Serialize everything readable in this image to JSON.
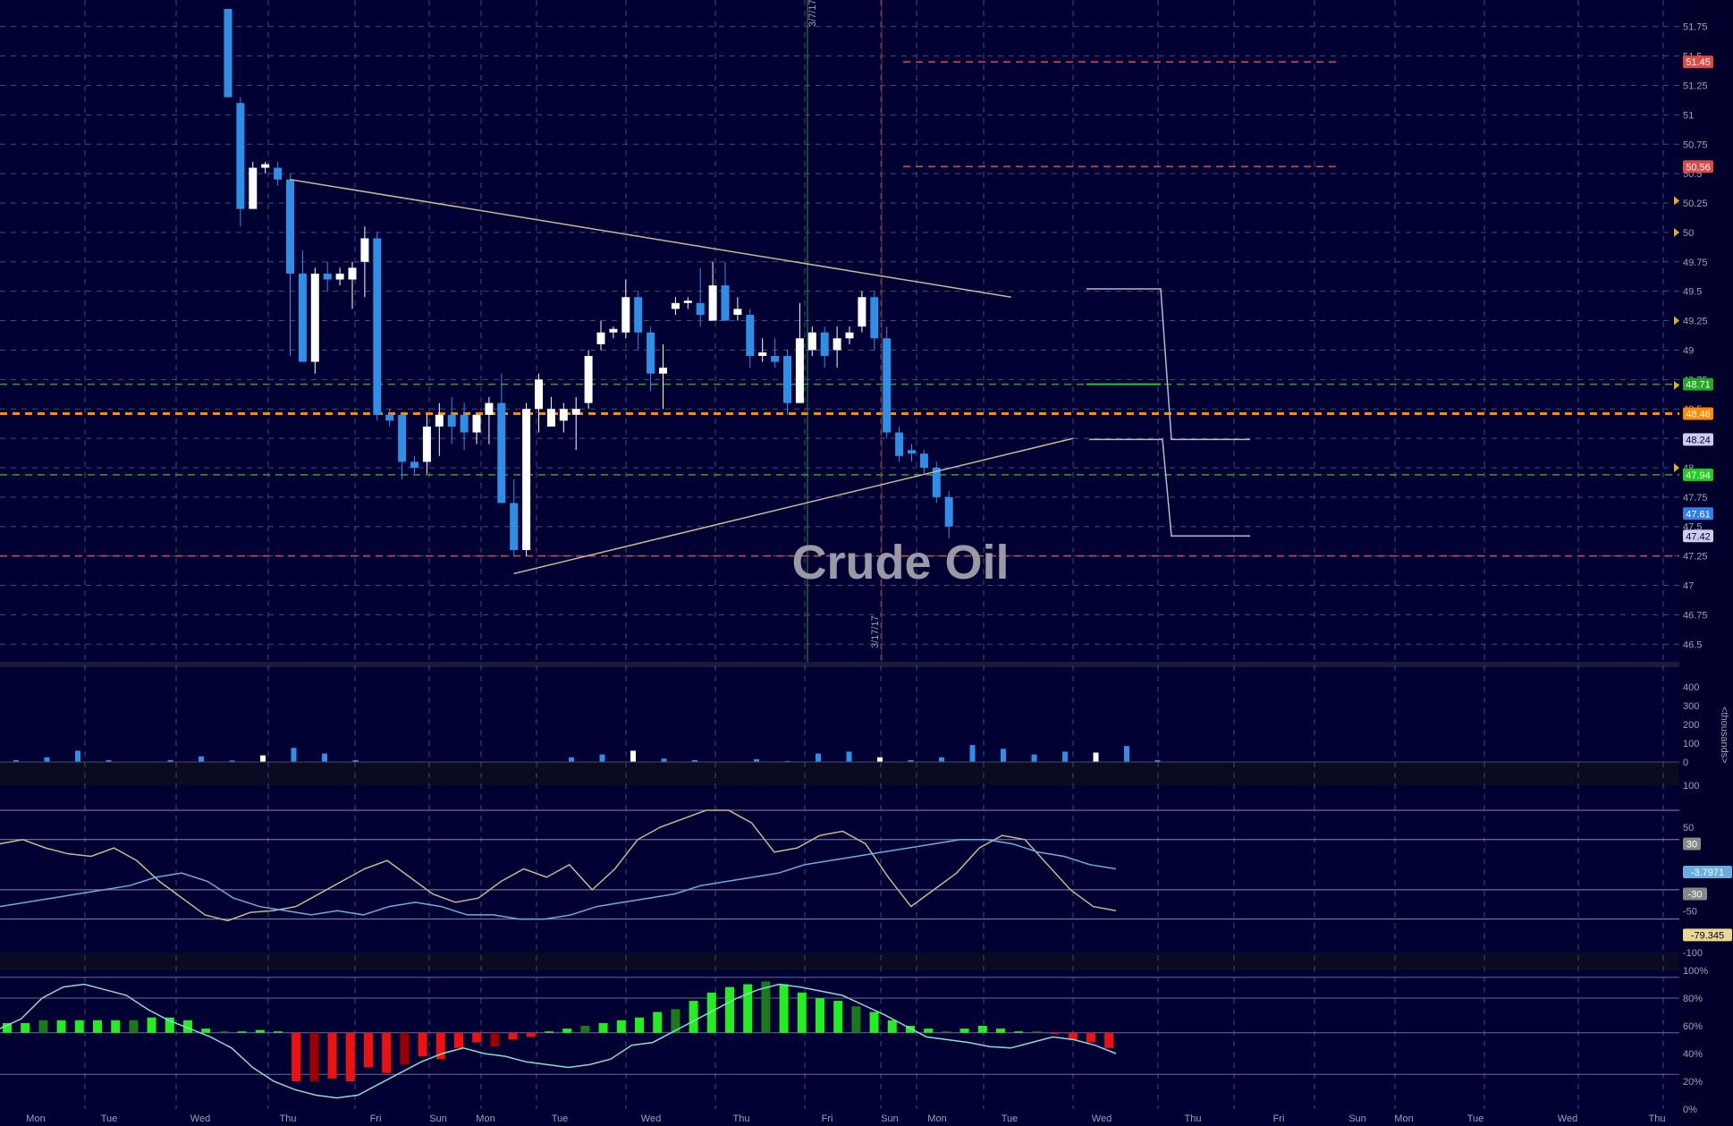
{
  "chart_data": {
    "type": "candlestick",
    "title": "Crude Oil",
    "date_labels": [
      "3/7/17",
      "3/17/17"
    ],
    "x_tick_labels": [
      "Mon",
      "Tue",
      "Wed",
      "Thu",
      "Fri",
      "Sun",
      "Mon",
      "Tue",
      "Wed",
      "Thu",
      "Fri",
      "Sun",
      "Mon",
      "Tue",
      "Wed",
      "Thu",
      "Fri",
      "Sun",
      "Mon",
      "Tue",
      "Wed",
      "Thu"
    ],
    "price_axis": {
      "ylim": [
        46.35,
        51.9
      ],
      "ticks": [
        "51.75",
        "51.5",
        "51.25",
        "51",
        "50.75",
        "50.5",
        "50.25",
        "50",
        "49.75",
        "49.5",
        "49.25",
        "49",
        "48.75",
        "48.5",
        "48.25",
        "48",
        "47.75",
        "47.5",
        "47.25",
        "47",
        "46.75",
        "46.5"
      ]
    },
    "price_badges": [
      {
        "label": "51.45",
        "value": 51.45,
        "color": "#e04848"
      },
      {
        "label": "50.56",
        "value": 50.56,
        "color": "#e04848"
      },
      {
        "label": "48.71",
        "value": 48.71,
        "color": "#22aa22"
      },
      {
        "label": "48.46",
        "value": 48.46,
        "color": "#ff8c00"
      },
      {
        "label": "48.24",
        "value": 48.24,
        "color": "#ccccee"
      },
      {
        "label": "47.94",
        "value": 47.94,
        "color": "#22cc22"
      },
      {
        "label": "47.61",
        "value": 47.61,
        "color": "#2f7fe6"
      },
      {
        "label": "47.42",
        "value": 47.42,
        "color": "#ccccee"
      }
    ],
    "levels": [
      {
        "value": 51.45,
        "style": "dashed",
        "color": "#e04848"
      },
      {
        "value": 50.56,
        "style": "dashed",
        "color": "#e04848"
      },
      {
        "value": 48.71,
        "style": "dashed",
        "color": "#22aa22"
      },
      {
        "value": 48.46,
        "style": "dashed",
        "color": "#ff8c00"
      },
      {
        "value": 47.94,
        "style": "dashed",
        "color": "#22aa22"
      },
      {
        "value": 47.25,
        "style": "dashed",
        "color": "#e04848"
      }
    ],
    "candles": [
      {
        "o": 51.9,
        "h": 51.9,
        "l": 51.15,
        "c": 51.15
      },
      {
        "o": 51.1,
        "h": 51.15,
        "l": 50.05,
        "c": 50.2
      },
      {
        "o": 50.2,
        "h": 50.6,
        "l": 50.2,
        "c": 50.55
      },
      {
        "o": 50.55,
        "h": 50.6,
        "l": 50.5,
        "c": 50.58
      },
      {
        "o": 50.55,
        "h": 50.6,
        "l": 50.4,
        "c": 50.45
      },
      {
        "o": 50.45,
        "h": 50.5,
        "l": 48.95,
        "c": 49.65
      },
      {
        "o": 49.65,
        "h": 49.85,
        "l": 48.9,
        "c": 48.9
      },
      {
        "o": 48.9,
        "h": 49.7,
        "l": 48.8,
        "c": 49.65
      },
      {
        "o": 49.65,
        "h": 49.75,
        "l": 49.5,
        "c": 49.6
      },
      {
        "o": 49.6,
        "h": 49.7,
        "l": 49.55,
        "c": 49.65
      },
      {
        "o": 49.6,
        "h": 49.75,
        "l": 49.35,
        "c": 49.7
      },
      {
        "o": 49.75,
        "h": 50.05,
        "l": 49.45,
        "c": 49.95
      },
      {
        "o": 49.95,
        "h": 50.0,
        "l": 48.4,
        "c": 48.45
      },
      {
        "o": 48.45,
        "h": 48.5,
        "l": 48.35,
        "c": 48.4
      },
      {
        "o": 48.45,
        "h": 48.45,
        "l": 47.9,
        "c": 48.05
      },
      {
        "o": 48.05,
        "h": 48.1,
        "l": 47.95,
        "c": 48.0
      },
      {
        "o": 48.05,
        "h": 48.45,
        "l": 47.95,
        "c": 48.35
      },
      {
        "o": 48.35,
        "h": 48.55,
        "l": 48.1,
        "c": 48.45
      },
      {
        "o": 48.45,
        "h": 48.6,
        "l": 48.2,
        "c": 48.35
      },
      {
        "o": 48.45,
        "h": 48.55,
        "l": 48.15,
        "c": 48.3
      },
      {
        "o": 48.3,
        "h": 48.45,
        "l": 48.2,
        "c": 48.45
      },
      {
        "o": 48.45,
        "h": 48.6,
        "l": 48.2,
        "c": 48.55
      },
      {
        "o": 48.55,
        "h": 48.8,
        "l": 47.7,
        "c": 47.7
      },
      {
        "o": 47.7,
        "h": 47.9,
        "l": 47.25,
        "c": 47.3
      },
      {
        "o": 47.3,
        "h": 48.55,
        "l": 47.25,
        "c": 48.5
      },
      {
        "o": 48.5,
        "h": 48.8,
        "l": 48.3,
        "c": 48.75
      },
      {
        "o": 48.35,
        "h": 48.6,
        "l": 48.35,
        "c": 48.5
      },
      {
        "o": 48.4,
        "h": 48.55,
        "l": 48.3,
        "c": 48.5
      },
      {
        "o": 48.45,
        "h": 48.6,
        "l": 48.15,
        "c": 48.5
      },
      {
        "o": 48.55,
        "h": 49.0,
        "l": 48.5,
        "c": 48.95
      },
      {
        "o": 49.05,
        "h": 49.25,
        "l": 49.0,
        "c": 49.15
      },
      {
        "o": 49.15,
        "h": 49.2,
        "l": 49.1,
        "c": 49.18
      },
      {
        "o": 49.15,
        "h": 49.6,
        "l": 49.1,
        "c": 49.45
      },
      {
        "o": 49.45,
        "h": 49.5,
        "l": 49.0,
        "c": 49.15
      },
      {
        "o": 49.15,
        "h": 49.2,
        "l": 48.65,
        "c": 48.8
      },
      {
        "o": 48.8,
        "h": 49.05,
        "l": 48.5,
        "c": 48.85
      },
      {
        "o": 49.35,
        "h": 49.45,
        "l": 49.3,
        "c": 49.4
      },
      {
        "o": 49.4,
        "h": 49.45,
        "l": 49.35,
        "c": 49.42
      },
      {
        "o": 49.4,
        "h": 49.7,
        "l": 49.2,
        "c": 49.3
      },
      {
        "o": 49.25,
        "h": 49.75,
        "l": 49.25,
        "c": 49.55
      },
      {
        "o": 49.55,
        "h": 49.75,
        "l": 49.25,
        "c": 49.25
      },
      {
        "o": 49.3,
        "h": 49.45,
        "l": 49.25,
        "c": 49.35
      },
      {
        "o": 49.3,
        "h": 49.35,
        "l": 48.85,
        "c": 48.95
      },
      {
        "o": 48.95,
        "h": 49.1,
        "l": 48.9,
        "c": 48.98
      },
      {
        "o": 48.95,
        "h": 49.1,
        "l": 48.85,
        "c": 48.9
      },
      {
        "o": 48.95,
        "h": 49.0,
        "l": 48.45,
        "c": 48.55
      },
      {
        "o": 48.55,
        "h": 49.4,
        "l": 48.55,
        "c": 49.1
      },
      {
        "o": 49.0,
        "h": 49.2,
        "l": 48.95,
        "c": 49.15
      },
      {
        "o": 49.15,
        "h": 49.2,
        "l": 48.85,
        "c": 48.95
      },
      {
        "o": 49.0,
        "h": 49.2,
        "l": 48.85,
        "c": 49.1
      },
      {
        "o": 49.1,
        "h": 49.2,
        "l": 49.05,
        "c": 49.15
      },
      {
        "o": 49.2,
        "h": 49.5,
        "l": 49.15,
        "c": 49.45
      },
      {
        "o": 49.45,
        "h": 49.5,
        "l": 49.0,
        "c": 49.1
      },
      {
        "o": 49.1,
        "h": 49.2,
        "l": 48.25,
        "c": 48.3
      },
      {
        "o": 48.3,
        "h": 48.35,
        "l": 48.05,
        "c": 48.1
      },
      {
        "o": 48.15,
        "h": 48.2,
        "l": 48.05,
        "c": 48.12
      },
      {
        "o": 48.12,
        "h": 48.15,
        "l": 47.95,
        "c": 48.0
      },
      {
        "o": 48.0,
        "h": 48.05,
        "l": 47.7,
        "c": 47.75
      },
      {
        "o": 47.75,
        "h": 47.8,
        "l": 47.4,
        "c": 47.5
      }
    ],
    "trendlines": [
      {
        "from": {
          "i": 5,
          "p": 50.45
        },
        "to": {
          "i": 63,
          "p": 49.45
        }
      },
      {
        "from": {
          "i": 23,
          "p": 47.1
        },
        "to": {
          "i": 68,
          "p": 48.25
        }
      }
    ],
    "projection": {
      "color": "#b8b8c8"
    },
    "volume_axis": {
      "label": "<thousands>",
      "ticks": [
        "400",
        "300",
        "200",
        "100",
        "0"
      ],
      "max": 400
    },
    "volume": [
      10,
      25,
      60,
      10,
      0,
      10,
      30,
      8,
      35,
      75,
      45,
      10,
      0,
      0,
      0,
      0,
      0,
      0,
      25,
      40,
      60,
      18,
      10,
      0,
      15,
      5,
      45,
      55,
      25,
      10,
      25,
      90,
      70,
      40,
      55,
      50,
      85,
      10
    ],
    "volume_colors_white": [
      8,
      20,
      28,
      35
    ],
    "oscillator": {
      "ticks": [
        "100",
        "50",
        "-50",
        "-100"
      ],
      "badges": [
        {
          "label": "30",
          "color": "#888888"
        },
        {
          "label": "-3.7971",
          "color": "#6aaee0"
        },
        {
          "label": "-30",
          "color": "#888888"
        },
        {
          "label": "-79.345",
          "color": "#e8d890"
        }
      ],
      "ylim": [
        -100,
        100
      ],
      "series": [
        {
          "name": "fast",
          "color": "#c8b890",
          "values": [
            30,
            35,
            25,
            18,
            15,
            25,
            10,
            -15,
            -35,
            -55,
            -62,
            -52,
            -50,
            -45,
            -30,
            -15,
            0,
            10,
            -10,
            -30,
            -40,
            -35,
            -15,
            0,
            -10,
            5,
            -25,
            0,
            35,
            50,
            60,
            70,
            70,
            55,
            20,
            25,
            40,
            45,
            30,
            -10,
            -45,
            -25,
            -5,
            25,
            40,
            35,
            5,
            -25,
            -45,
            -50
          ]
        },
        {
          "name": "slow",
          "color": "#6aaee0",
          "values": [
            -45,
            -40,
            -35,
            -30,
            -25,
            -20,
            -10,
            -5,
            -15,
            -35,
            -45,
            -50,
            -55,
            -50,
            -55,
            -45,
            -40,
            -45,
            -55,
            -55,
            -60,
            -60,
            -55,
            -45,
            -40,
            -35,
            -30,
            -20,
            -15,
            -10,
            -5,
            5,
            10,
            15,
            20,
            25,
            30,
            35,
            35,
            30,
            20,
            15,
            5,
            0
          ]
        }
      ]
    },
    "histogram": {
      "ticks": [
        "100%",
        "80%",
        "60%",
        "40%",
        "20%",
        "0%"
      ],
      "ylim": [
        0,
        100
      ],
      "zero": 55,
      "bars": [
        62,
        62,
        64,
        64,
        64,
        64,
        64,
        64,
        66,
        66,
        64,
        58,
        56,
        56,
        57,
        56,
        20,
        20,
        22,
        20,
        30,
        26,
        32,
        38,
        36,
        44,
        48,
        45,
        50,
        52,
        56,
        58,
        60,
        62,
        64,
        66,
        70,
        72,
        78,
        84,
        88,
        90,
        92,
        90,
        84,
        80,
        78,
        74,
        70,
        64,
        60,
        58,
        56,
        58,
        60,
        58,
        56,
        56,
        54,
        50,
        48,
        44
      ]
    },
    "histogram_line": [
      58,
      65,
      80,
      88,
      90,
      86,
      82,
      72,
      64,
      58,
      52,
      44,
      30,
      20,
      14,
      10,
      8,
      10,
      18,
      26,
      34,
      40,
      44,
      40,
      38,
      34,
      32,
      30,
      32,
      36,
      46,
      48,
      56,
      64,
      72,
      80,
      86,
      90,
      88,
      85,
      82,
      75,
      68,
      60,
      52,
      50,
      48,
      45,
      44,
      48,
      52,
      50,
      46,
      40
    ]
  }
}
